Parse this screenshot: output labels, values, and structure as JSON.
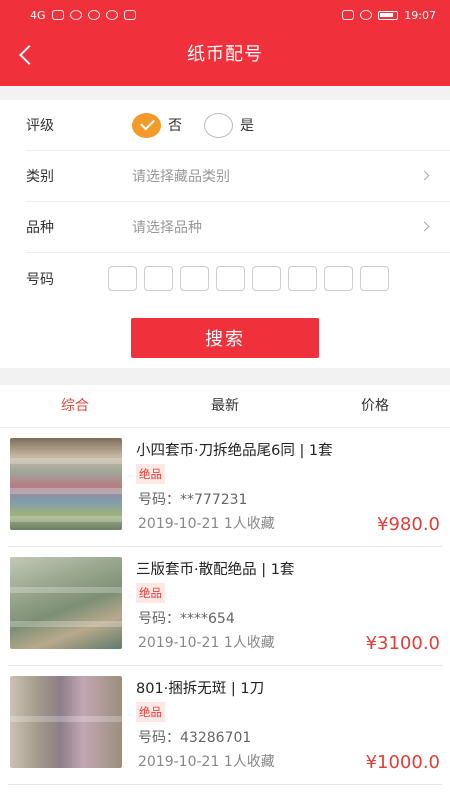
{
  "status": {
    "network": "4G",
    "time": "19:07"
  },
  "nav": {
    "title": "纸币配号"
  },
  "form": {
    "grade_label": "评级",
    "grade_options": [
      {
        "label": "否",
        "selected": true
      },
      {
        "label": "是",
        "selected": false
      }
    ],
    "category_label": "类别",
    "category_placeholder": "请选择藏品类别",
    "variety_label": "品种",
    "variety_placeholder": "请选择品种",
    "number_label": "号码",
    "number_boxes": 8,
    "search_label": "搜索"
  },
  "tabs": [
    {
      "label": "综合",
      "active": true
    },
    {
      "label": "最新",
      "active": false
    },
    {
      "label": "价格",
      "active": false
    }
  ],
  "list": [
    {
      "name": "小四套币·刀拆绝品尾6同 | 1套",
      "grade": "绝品",
      "code_label": "号码：",
      "code": "**777231",
      "date": "2019-10-21",
      "favorites": "1人收藏",
      "price": "¥980.0"
    },
    {
      "name": "三版套币·散配绝品 | 1套",
      "grade": "绝品",
      "code_label": "号码：",
      "code": "****654",
      "date": "2019-10-21",
      "favorites": "1人收藏",
      "price": "¥3100.0"
    },
    {
      "name": "801·捆拆无斑 | 1刀",
      "grade": "绝品",
      "code_label": "号码：",
      "code": "43286701",
      "date": "2019-10-21",
      "favorites": "1人收藏",
      "price": "¥1000.0"
    }
  ],
  "colors": {
    "brand": "#f0303a",
    "accent": "#e0403a",
    "radio_on": "#f39a2a"
  }
}
